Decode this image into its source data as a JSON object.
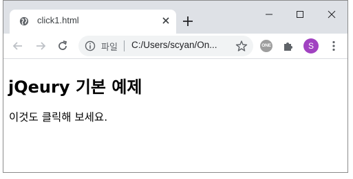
{
  "tab": {
    "title": "click1.html"
  },
  "omnibox": {
    "security_label": "파일",
    "url": "C:/Users/scyan/On..."
  },
  "extensions": {
    "one_label": "ONE"
  },
  "profile": {
    "initial": "S",
    "color": "#a142c1"
  },
  "page": {
    "heading": "jQeury 기본 예제",
    "paragraph": "이것도 클릭해 보세요."
  },
  "colors": {
    "titlebar": "#dee1e6",
    "omnibox_bg": "#f1f3f4",
    "icon": "#5f6368"
  }
}
